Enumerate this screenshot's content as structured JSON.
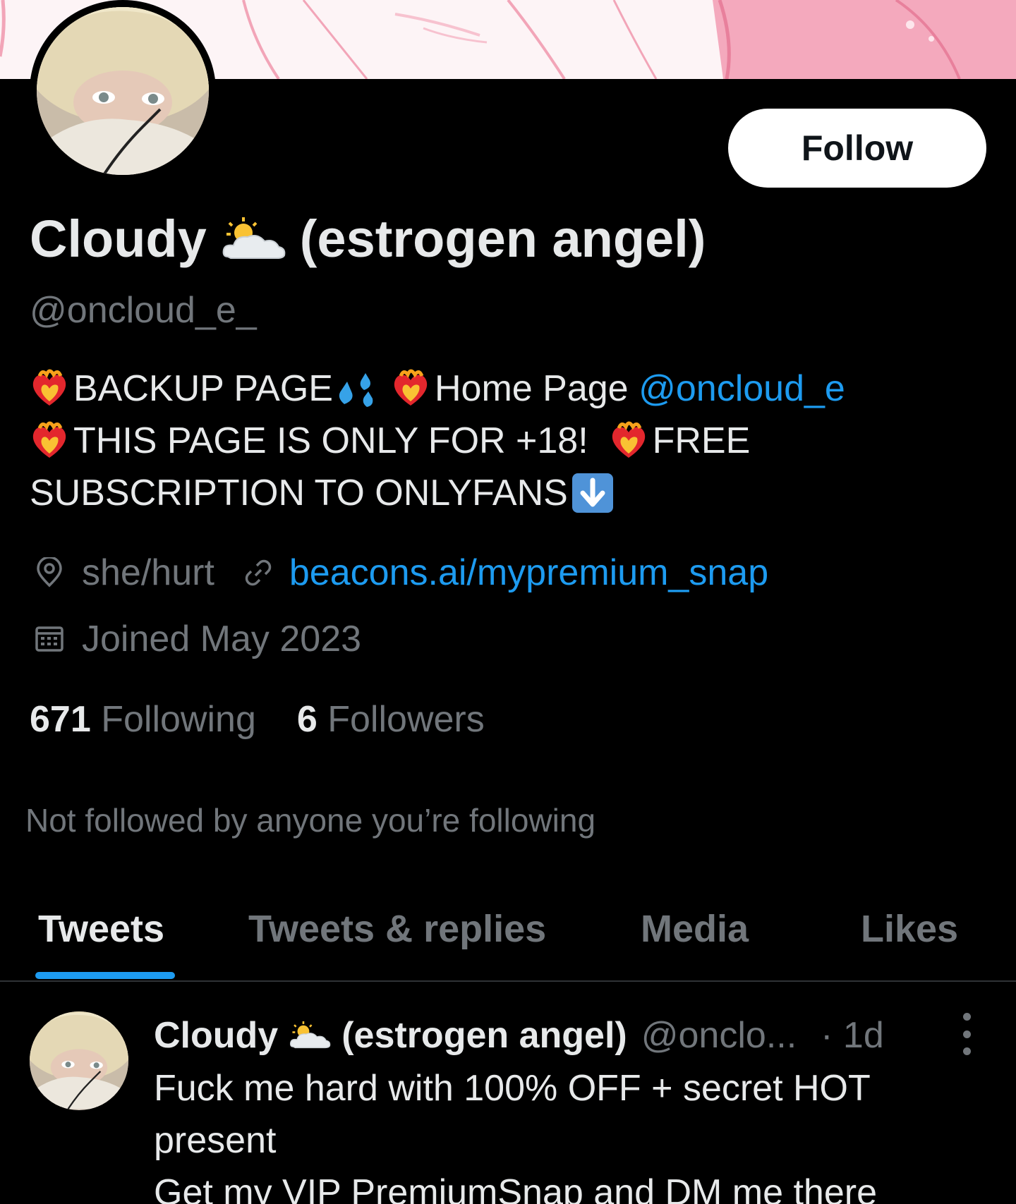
{
  "profile": {
    "follow_label": "Follow",
    "display_name": "Cloudy",
    "display_name_suffix": "(estrogen angel)",
    "name_emoji": "sun-behind-cloud-icon",
    "handle": "@oncloud_e_"
  },
  "bio": {
    "line1_a": "BACKUP PAGE",
    "line1_b": "Home Page",
    "line1_link": "@oncloud_e",
    "line2_a": "THIS PAGE IS ONLY FOR +18!",
    "line2_b": "FREE",
    "line3": "SUBSCRIPTION TO ONLYFANS"
  },
  "meta": {
    "location": "she/hurt",
    "website": "beacons.ai/mypremium_snap",
    "joined": "Joined May 2023"
  },
  "stats": {
    "following_count": "671",
    "following_label": "Following",
    "followers_count": "6",
    "followers_label": "Followers"
  },
  "not_followed_text": "Not followed by anyone you’re following",
  "tabs": [
    {
      "label": "Tweets",
      "active": true
    },
    {
      "label": "Tweets & replies",
      "active": false
    },
    {
      "label": "Media",
      "active": false
    },
    {
      "label": "Likes",
      "active": false
    }
  ],
  "tweet": {
    "name": "Cloudy",
    "name_suffix": "(estrogen angel)",
    "handle": "@onclo...",
    "time": "· 1d",
    "lines": [
      "Fuck me hard with 100% OFF + secret HOT",
      "present",
      "Get my VIP PremiumSnap and DM me there"
    ]
  },
  "colors": {
    "background": "#000000",
    "text": "#e7e9ea",
    "muted": "#71767b",
    "link": "#1d9bf0",
    "banner": "#fdf4f6",
    "banner_pink": "#f4a9bd"
  }
}
